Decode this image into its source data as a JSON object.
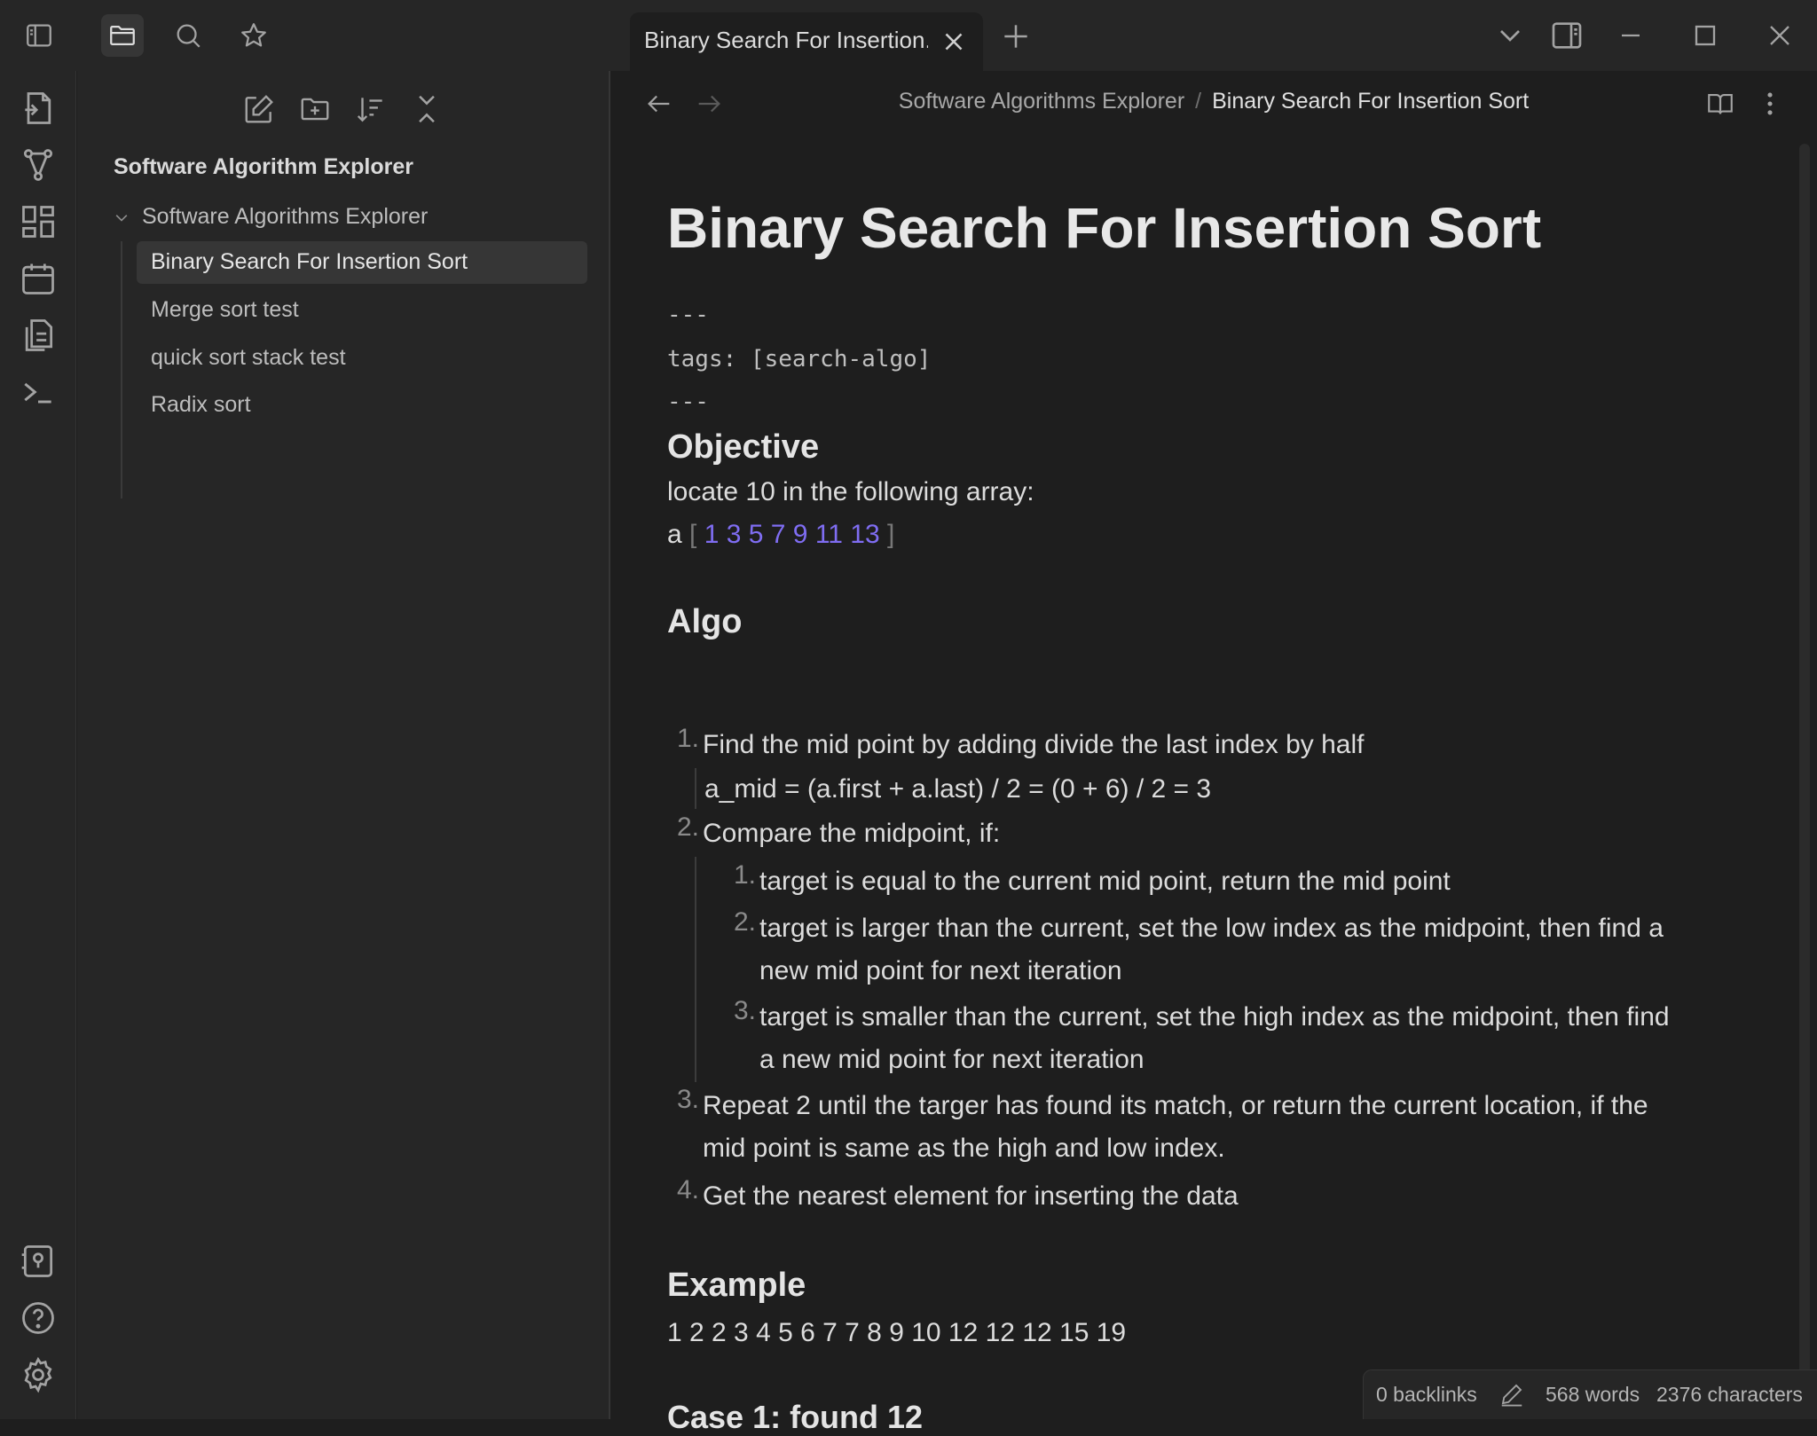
{
  "tab": {
    "title": "Binary Search For Insertion..."
  },
  "breadcrumb": {
    "parent": "Software Algorithms Explorer",
    "separator": "/",
    "current": "Binary Search For Insertion Sort"
  },
  "sidebar": {
    "vault_name": "Software Algorithm Explorer",
    "folder": "Software Algorithms Explorer",
    "files": [
      "Binary Search For Insertion Sort",
      "Merge sort test",
      "quick sort stack test",
      "Radix sort"
    ]
  },
  "note": {
    "title": "Binary Search For Insertion Sort",
    "frontmatter": {
      "open": "---",
      "tags": "tags: [search-algo]",
      "close": "---"
    },
    "objective_heading": "Objective",
    "objective_text": "locate 10 in the following array:",
    "array_label": "a",
    "array_open": "[",
    "array_values": "1 3 5 7 9 11 13",
    "array_close": "]",
    "algo_heading": "Algo",
    "steps": {
      "n1": "1.",
      "s1": "Find the mid point by adding divide the last index by half",
      "s1_sub": "a_mid = (a.first + a.last) / 2 = (0 + 6) / 2 = 3",
      "n2": "2.",
      "s2": "Compare the midpoint, if:",
      "sub_n1": "1.",
      "sub1": "target is equal to the current mid point, return the mid point",
      "sub_n2": "2.",
      "sub2_l1": "target is larger than the current, set the low index as the midpoint, then find a",
      "sub2_l2": "new mid point for next iteration",
      "sub_n3": "3.",
      "sub3_l1": "target is smaller than the current, set the high index as the midpoint, then find",
      "sub3_l2": "a new mid point for next iteration",
      "n3": "3.",
      "s3_l1": "Repeat 2 until the targer has found its match, or return the current location, if the",
      "s3_l2": "mid point is same as the high and low index.",
      "n4": "4.",
      "s4": "Get the nearest element for inserting the data"
    },
    "example_heading": "Example",
    "example_text": "1 2 2 3 4 5 6 7 7 8 9 10 12 12 12 15 19",
    "case_heading": "Case 1: found 12"
  },
  "status": {
    "backlinks": "0 backlinks",
    "words": "568 words",
    "characters": "2376 characters"
  },
  "theme": {
    "accent": "#7f6df2",
    "background": "#1e1e1e",
    "panel": "#262626"
  }
}
